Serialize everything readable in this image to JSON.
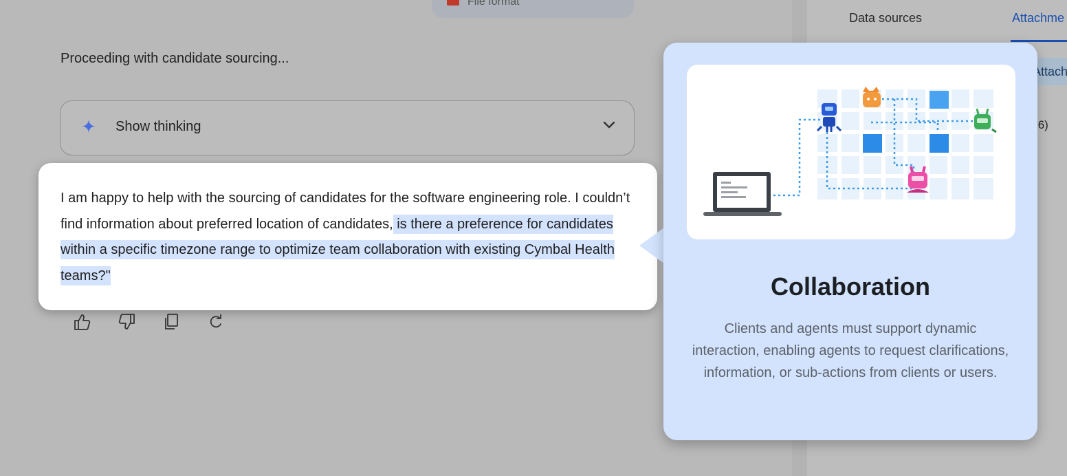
{
  "side_panel": {
    "tabs": [
      {
        "label": "Data sources"
      },
      {
        "label": "Attachme"
      }
    ],
    "attach_button": "Attach",
    "partial_value": ".6)"
  },
  "file_chip": {
    "label": "File format"
  },
  "chat": {
    "status": "Proceeding with candidate sourcing...",
    "thinking_label": "Show thinking",
    "message": {
      "plain": "I am happy to help with the sourcing of candidates for the software engineering role. I couldn’t find information about preferred location of candidates,",
      "highlighted": " is there a preference for candidates within a specific timezone range to optimize team collaboration with existing Cymbal Health teams?\""
    },
    "actions": [
      "thumb-up",
      "thumb-down",
      "copy",
      "regenerate"
    ]
  },
  "callout": {
    "title": "Collaboration",
    "body": "Clients and agents must support dynamic interaction, enabling agents to request clarifications, information, or sub-actions from clients or users."
  },
  "colors": {
    "highlight": "#d3e3fd",
    "callout_bg": "#d3e3fd",
    "accent": "#1a4fb0"
  }
}
